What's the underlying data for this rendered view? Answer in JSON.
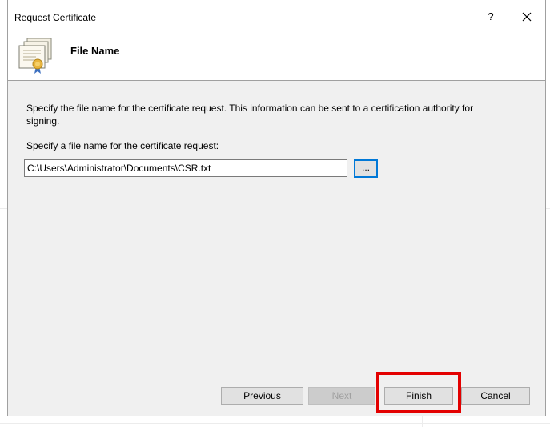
{
  "window": {
    "title": "Request Certificate",
    "help_label": "?"
  },
  "header": {
    "title": "File Name",
    "icon": "certificate-icon"
  },
  "content": {
    "description": "Specify the file name for the certificate request. This information can be sent to a certification authority for signing.",
    "field_label": "Specify a file name for the certificate request:",
    "file_path": "C:\\Users\\Administrator\\Documents\\CSR.txt",
    "browse_label": "..."
  },
  "footer": {
    "previous_label": "Previous",
    "next_label": "Next",
    "finish_label": "Finish",
    "cancel_label": "Cancel"
  },
  "colors": {
    "highlight": "#e30000",
    "accent": "#0078d7",
    "panel": "#f0f0f0"
  }
}
